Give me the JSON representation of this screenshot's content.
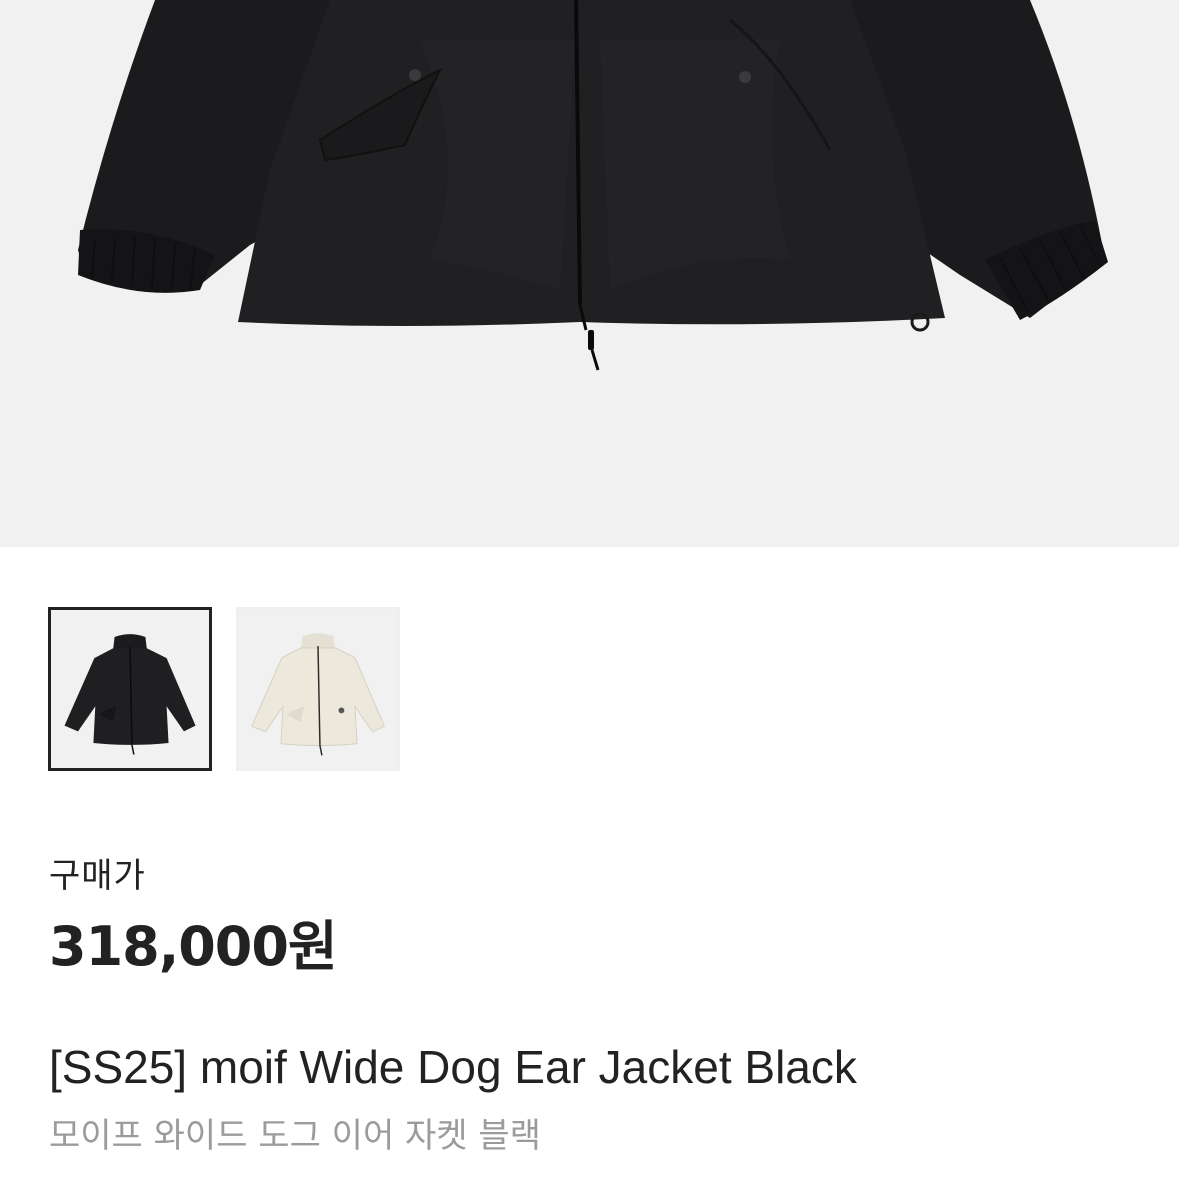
{
  "hero": {
    "image": "black-jacket-product-photo"
  },
  "thumbnails": [
    {
      "image": "black-jacket-thumbnail",
      "selected": true
    },
    {
      "image": "ivory-jacket-thumbnail",
      "selected": false
    }
  ],
  "price": {
    "label": "구매가",
    "value": "318,000원"
  },
  "product": {
    "name_en": "[SS25] moif Wide Dog Ear Jacket Black",
    "name_ko": "모이프 와이드 도그 이어 자켓 블랙"
  },
  "colors": {
    "hero_bg": "#f1f1f1",
    "text_primary": "#222222",
    "text_secondary": "#9b9b9b",
    "jacket_black": "#1c1c1e",
    "jacket_ivory": "#ece8dc"
  }
}
